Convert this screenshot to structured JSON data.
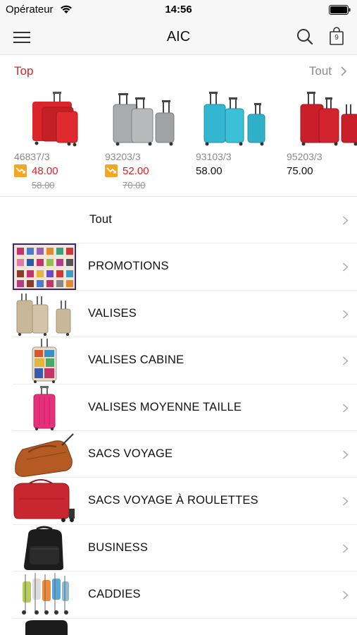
{
  "status_bar": {
    "carrier": "Opérateur",
    "time": "14:56"
  },
  "nav": {
    "title": "AIC",
    "cart_count": "9"
  },
  "top": {
    "label": "Top",
    "all_label": "Tout",
    "products": [
      {
        "ref": "46837/3",
        "price": "48.00",
        "old_price": "58.00",
        "on_sale": true,
        "color": "#d8262b"
      },
      {
        "ref": "93203/3",
        "price": "52.00",
        "old_price": "70.00",
        "on_sale": true,
        "color": "#a9abad"
      },
      {
        "ref": "93103/3",
        "price": "58.00",
        "old_price": "",
        "on_sale": false,
        "color": "#33b6cf"
      },
      {
        "ref": "95203/3",
        "price": "75.00",
        "old_price": "",
        "on_sale": false,
        "color": "#c81f2a"
      }
    ]
  },
  "categories": [
    {
      "label": "Tout",
      "thumb": "none"
    },
    {
      "label": "PROMOTIONS",
      "thumb": "promo-collage"
    },
    {
      "label": "VALISES",
      "thumb": "beige-suitcases"
    },
    {
      "label": "VALISES CABINE",
      "thumb": "printed-cabin-suitcase"
    },
    {
      "label": "VALISES MOYENNE TAILLE",
      "thumb": "pink-suitcase"
    },
    {
      "label": "SACS VOYAGE",
      "thumb": "brown-travel-bag"
    },
    {
      "label": "SACS VOYAGE À ROULETTES",
      "thumb": "red-rolling-bag"
    },
    {
      "label": "BUSINESS",
      "thumb": "black-backpack"
    },
    {
      "label": "CADDIES",
      "thumb": "shopping-trolleys"
    }
  ],
  "colors": {
    "accent_red": "#e02020",
    "sale_badge": "#f5a623",
    "muted_text": "#8a8a8a"
  }
}
